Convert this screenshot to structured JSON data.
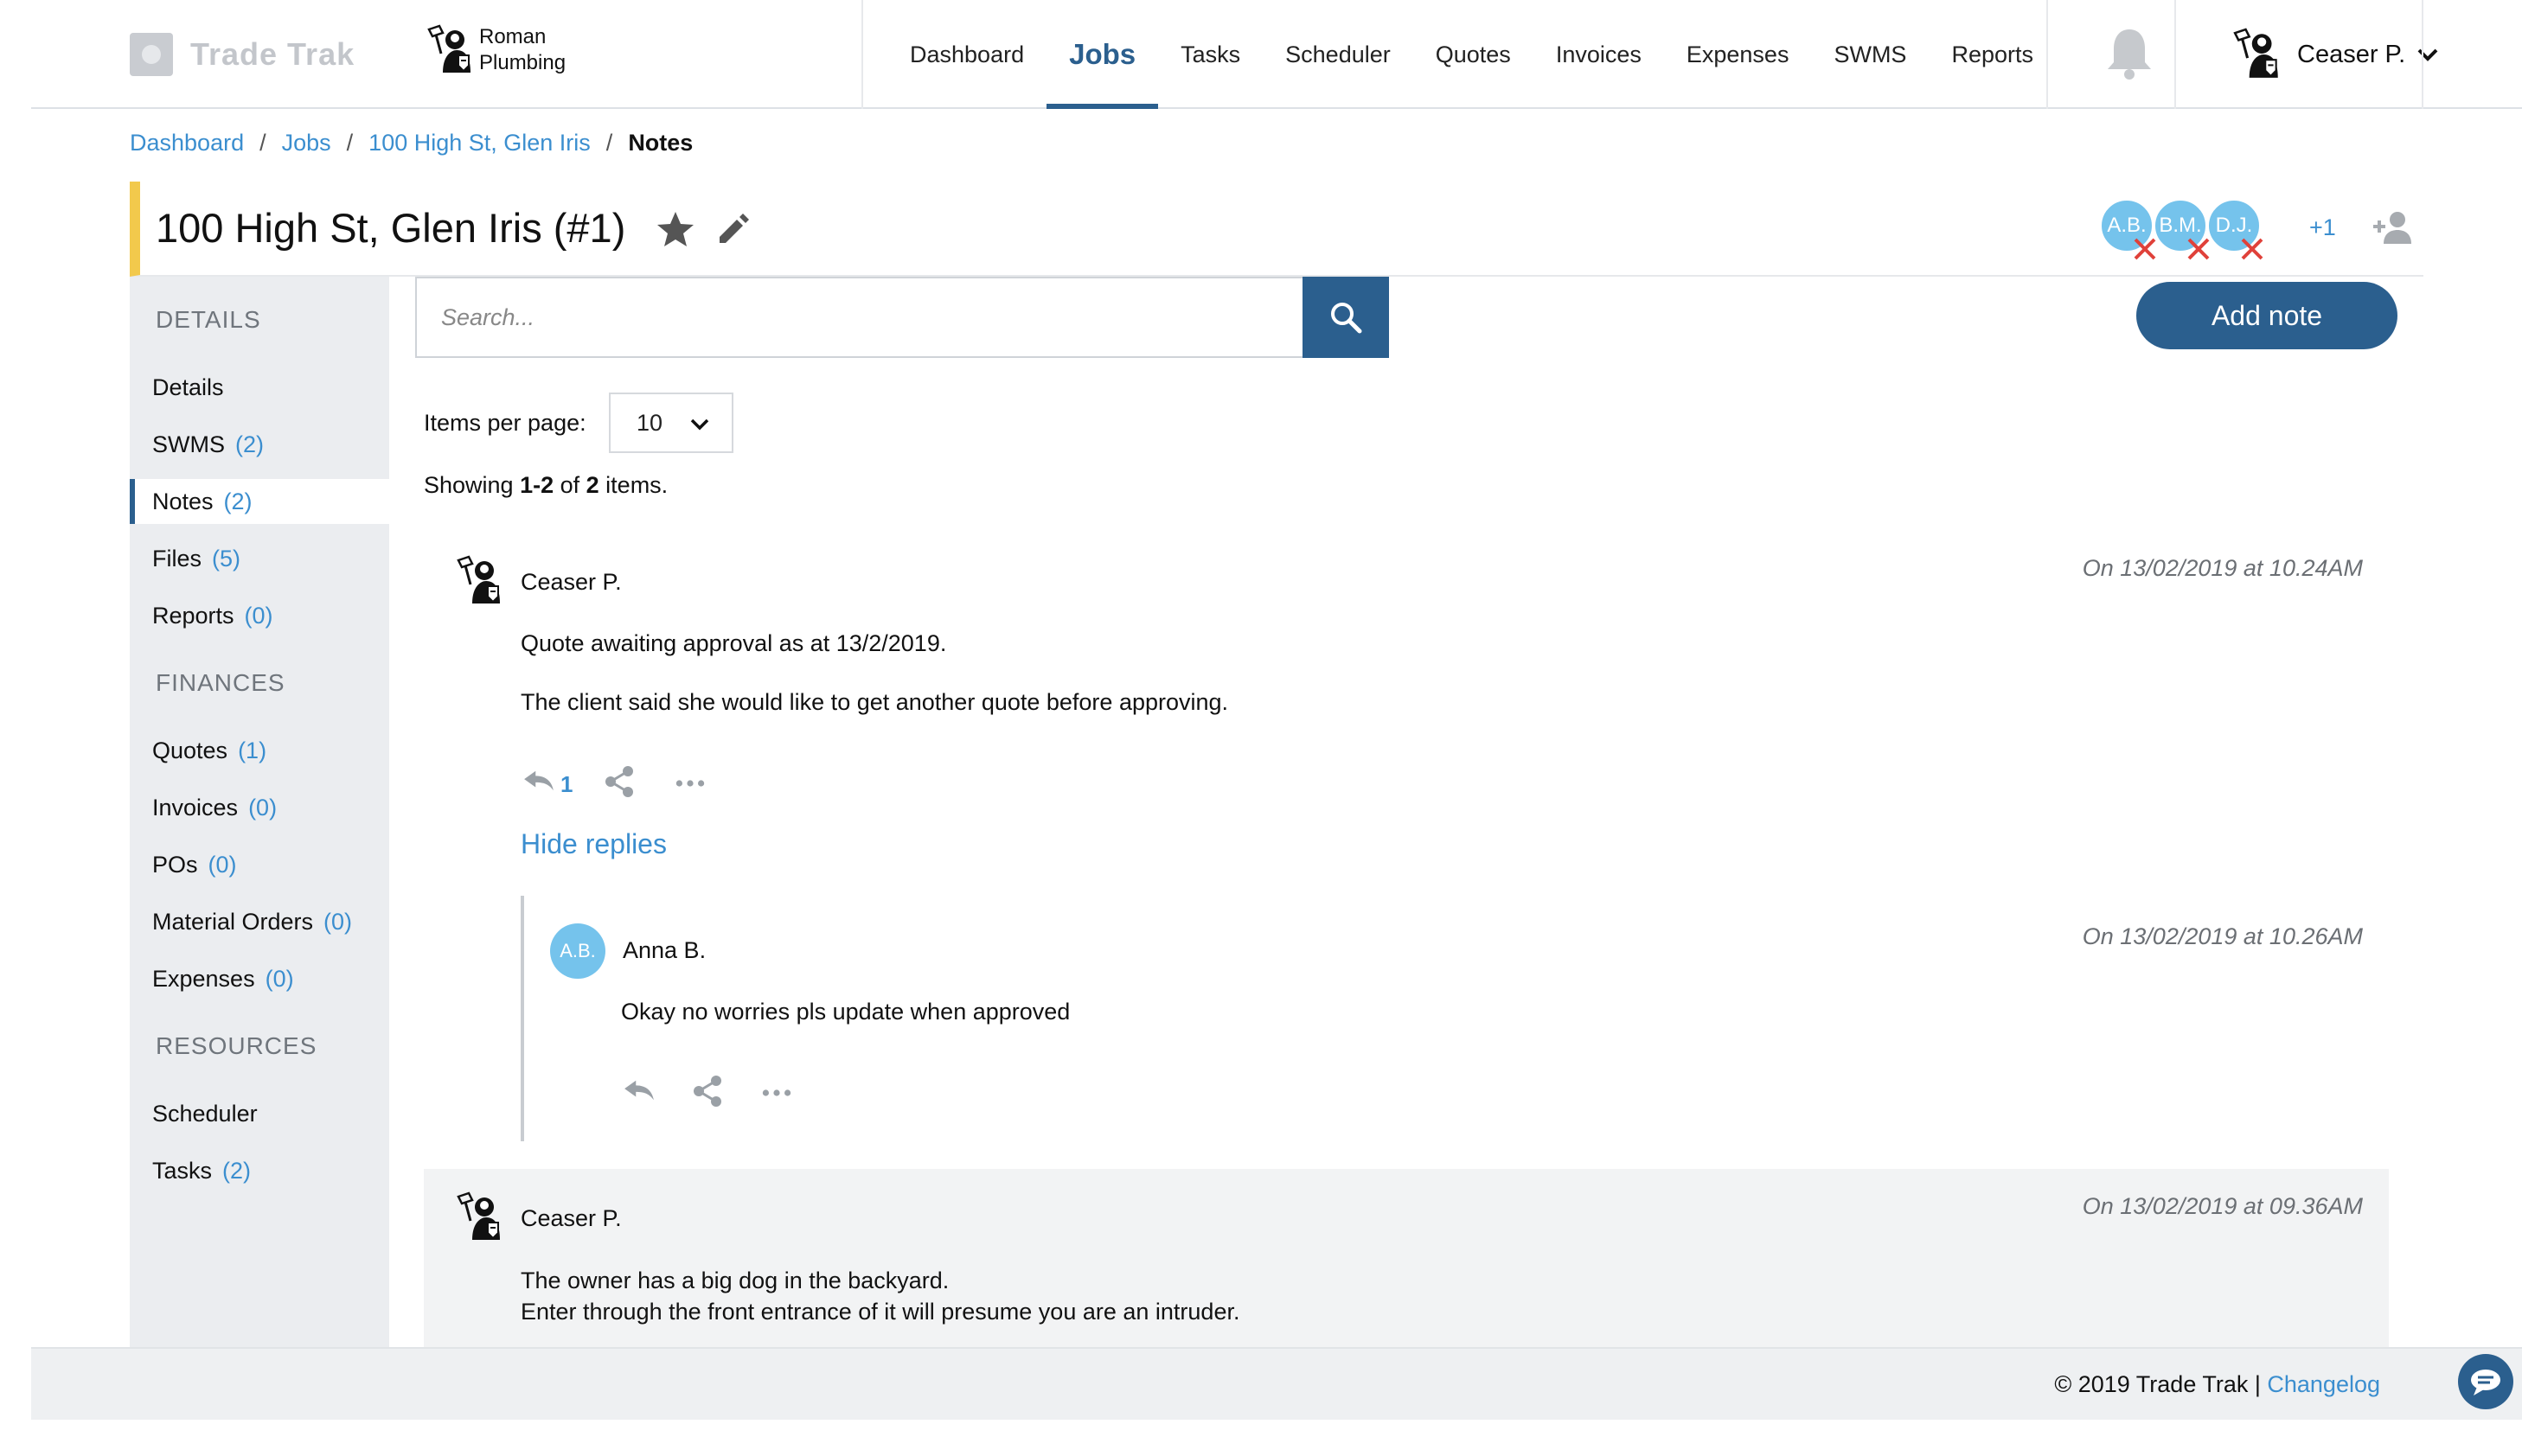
{
  "app": {
    "name": "Trade Trak"
  },
  "company": {
    "name_line1": "Roman",
    "name_line2": "Plumbing"
  },
  "nav": {
    "items": [
      "Dashboard",
      "Jobs",
      "Tasks",
      "Scheduler",
      "Quotes",
      "Invoices",
      "Expenses",
      "SWMS",
      "Reports"
    ],
    "active": "Jobs"
  },
  "user": {
    "name": "Ceaser P."
  },
  "breadcrumb": {
    "items": [
      "Dashboard",
      "Jobs",
      "100 High St, Glen Iris"
    ],
    "current": "Notes"
  },
  "job": {
    "title": "100 High St, Glen Iris (#1)",
    "assignees": [
      "A.B.",
      "B.M.",
      "D.J."
    ],
    "more_assignees": "+1"
  },
  "sidebar": {
    "details_heading": "DETAILS",
    "details": [
      {
        "label": "Details",
        "count": ""
      },
      {
        "label": "SWMS",
        "count": "(2)"
      },
      {
        "label": "Notes",
        "count": "(2)"
      },
      {
        "label": "Files",
        "count": "(5)"
      },
      {
        "label": "Reports",
        "count": "(0)"
      }
    ],
    "finances_heading": "FINANCES",
    "finances": [
      {
        "label": "Quotes",
        "count": "(1)"
      },
      {
        "label": "Invoices",
        "count": "(0)"
      },
      {
        "label": "POs",
        "count": "(0)"
      },
      {
        "label": "Material Orders",
        "count": "(0)"
      },
      {
        "label": "Expenses",
        "count": "(0)"
      }
    ],
    "resources_heading": "RESOURCES",
    "resources": [
      {
        "label": "Scheduler",
        "count": ""
      },
      {
        "label": "Tasks",
        "count": "(2)"
      }
    ]
  },
  "search": {
    "placeholder": "Search...",
    "value": ""
  },
  "add_note_label": "Add note",
  "pagination": {
    "items_per_page_label": "Items per page:",
    "items_per_page": "10",
    "showing_prefix": "Showing ",
    "showing_range": "1-2",
    "showing_of": " of ",
    "showing_total": "2",
    "showing_suffix": " items."
  },
  "notes": [
    {
      "author": "Ceaser P.",
      "time": "On 13/02/2019 at 10.24AM",
      "lines": [
        "Quote awaiting approval as at 13/2/2019.",
        "The client said she would like to get another quote before approving."
      ],
      "reply_count": "1",
      "hide_replies_label": "Hide replies",
      "replies": [
        {
          "author": "Anna B.",
          "initials": "A.B.",
          "time": "On 13/02/2019 at 10.26AM",
          "text": "Okay no worries pls update when approved"
        }
      ]
    },
    {
      "author": "Ceaser P.",
      "time": "On 13/02/2019 at 09.36AM",
      "lines": [
        "The owner has a big dog in the backyard.",
        "Enter through the front entrance of it will presume you are an intruder."
      ]
    }
  ],
  "footer": {
    "copyright": "© 2019 Trade Trak | ",
    "changelog": "Changelog"
  },
  "colors": {
    "primary": "#2b5f8e",
    "link": "#3b8ecf",
    "accent_yellow": "#f2c94c",
    "avatar_blue": "#75c3ec",
    "remove_red": "#e0413a"
  }
}
